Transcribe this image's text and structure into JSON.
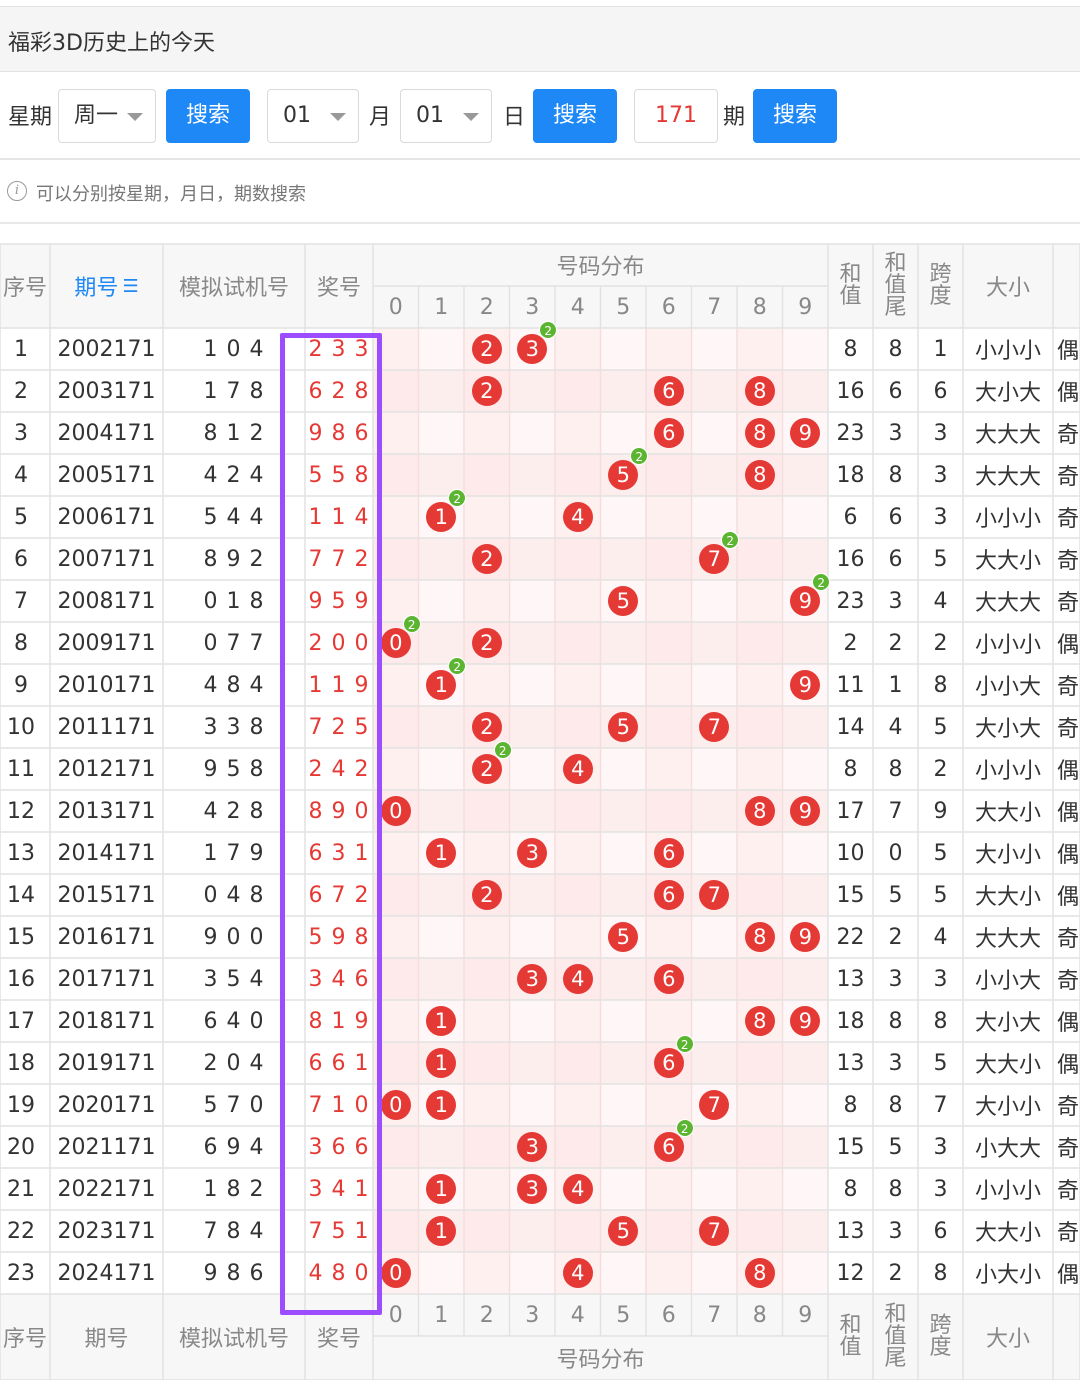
{
  "title": "福彩3D历史上的今天",
  "filters": {
    "weekday_label": "星期",
    "weekday_value": "周一",
    "search_label": "搜索",
    "month_value": "01",
    "month_label": "月",
    "day_value": "01",
    "day_label": "日",
    "issue_value": "171",
    "issue_label": "期"
  },
  "tip": "可以分别按星期，月日，期数搜索",
  "colors": {
    "ball": "#e53935",
    "badge": "#5cb531",
    "button": "#1e88f7",
    "highlight": "#9b4dff"
  },
  "table": {
    "headers": {
      "seq": "序号",
      "issue": "期号",
      "sim": "模拟试机号",
      "prize": "奖号",
      "dist": "号码分布",
      "sum": "和值",
      "tail": "和值尾",
      "span": "跨度",
      "size": "大小"
    },
    "digits": [
      "0",
      "1",
      "2",
      "3",
      "4",
      "5",
      "6",
      "7",
      "8",
      "9"
    ],
    "rows": [
      {
        "seq": "1",
        "issue": "2002171",
        "sim": "1 0 4",
        "prize": "2 3 3",
        "sum": "8",
        "tail": "8",
        "span": "1",
        "size": "小小小",
        "odd": "偶"
      },
      {
        "seq": "2",
        "issue": "2003171",
        "sim": "1 7 8",
        "prize": "6 2 8",
        "sum": "16",
        "tail": "6",
        "span": "6",
        "size": "大小大",
        "odd": "偶"
      },
      {
        "seq": "3",
        "issue": "2004171",
        "sim": "8 1 2",
        "prize": "9 8 6",
        "sum": "23",
        "tail": "3",
        "span": "3",
        "size": "大大大",
        "odd": "奇"
      },
      {
        "seq": "4",
        "issue": "2005171",
        "sim": "4 2 4",
        "prize": "5 5 8",
        "sum": "18",
        "tail": "8",
        "span": "3",
        "size": "大大大",
        "odd": "奇"
      },
      {
        "seq": "5",
        "issue": "2006171",
        "sim": "5 4 4",
        "prize": "1 1 4",
        "sum": "6",
        "tail": "6",
        "span": "3",
        "size": "小小小",
        "odd": "奇"
      },
      {
        "seq": "6",
        "issue": "2007171",
        "sim": "8 9 2",
        "prize": "7 7 2",
        "sum": "16",
        "tail": "6",
        "span": "5",
        "size": "大大小",
        "odd": "奇"
      },
      {
        "seq": "7",
        "issue": "2008171",
        "sim": "0 1 8",
        "prize": "9 5 9",
        "sum": "23",
        "tail": "3",
        "span": "4",
        "size": "大大大",
        "odd": "奇"
      },
      {
        "seq": "8",
        "issue": "2009171",
        "sim": "0 7 7",
        "prize": "2 0 0",
        "sum": "2",
        "tail": "2",
        "span": "2",
        "size": "小小小",
        "odd": "偶"
      },
      {
        "seq": "9",
        "issue": "2010171",
        "sim": "4 8 4",
        "prize": "1 1 9",
        "sum": "11",
        "tail": "1",
        "span": "8",
        "size": "小小大",
        "odd": "奇"
      },
      {
        "seq": "10",
        "issue": "2011171",
        "sim": "3 3 8",
        "prize": "7 2 5",
        "sum": "14",
        "tail": "4",
        "span": "5",
        "size": "大小大",
        "odd": "奇"
      },
      {
        "seq": "11",
        "issue": "2012171",
        "sim": "9 5 8",
        "prize": "2 4 2",
        "sum": "8",
        "tail": "8",
        "span": "2",
        "size": "小小小",
        "odd": "偶"
      },
      {
        "seq": "12",
        "issue": "2013171",
        "sim": "4 2 8",
        "prize": "8 9 0",
        "sum": "17",
        "tail": "7",
        "span": "9",
        "size": "大大小",
        "odd": "偶"
      },
      {
        "seq": "13",
        "issue": "2014171",
        "sim": "1 7 9",
        "prize": "6 3 1",
        "sum": "10",
        "tail": "0",
        "span": "5",
        "size": "大小小",
        "odd": "偶"
      },
      {
        "seq": "14",
        "issue": "2015171",
        "sim": "0 4 8",
        "prize": "6 7 2",
        "sum": "15",
        "tail": "5",
        "span": "5",
        "size": "大大小",
        "odd": "偶"
      },
      {
        "seq": "15",
        "issue": "2016171",
        "sim": "9 0 0",
        "prize": "5 9 8",
        "sum": "22",
        "tail": "2",
        "span": "4",
        "size": "大大大",
        "odd": "奇"
      },
      {
        "seq": "16",
        "issue": "2017171",
        "sim": "3 5 4",
        "prize": "3 4 6",
        "sum": "13",
        "tail": "3",
        "span": "3",
        "size": "小小大",
        "odd": "奇"
      },
      {
        "seq": "17",
        "issue": "2018171",
        "sim": "6 4 0",
        "prize": "8 1 9",
        "sum": "18",
        "tail": "8",
        "span": "8",
        "size": "大小大",
        "odd": "偶"
      },
      {
        "seq": "18",
        "issue": "2019171",
        "sim": "2 0 4",
        "prize": "6 6 1",
        "sum": "13",
        "tail": "3",
        "span": "5",
        "size": "大大小",
        "odd": "偶"
      },
      {
        "seq": "19",
        "issue": "2020171",
        "sim": "5 7 0",
        "prize": "7 1 0",
        "sum": "8",
        "tail": "8",
        "span": "7",
        "size": "大小小",
        "odd": "奇"
      },
      {
        "seq": "20",
        "issue": "2021171",
        "sim": "6 9 4",
        "prize": "3 6 6",
        "sum": "15",
        "tail": "5",
        "span": "3",
        "size": "小大大",
        "odd": "奇"
      },
      {
        "seq": "21",
        "issue": "2022171",
        "sim": "1 8 2",
        "prize": "3 4 1",
        "sum": "8",
        "tail": "8",
        "span": "3",
        "size": "小小小",
        "odd": "奇"
      },
      {
        "seq": "22",
        "issue": "2023171",
        "sim": "7 8 4",
        "prize": "7 5 1",
        "sum": "13",
        "tail": "3",
        "span": "6",
        "size": "大大小",
        "odd": "奇"
      },
      {
        "seq": "23",
        "issue": "2024171",
        "sim": "9 8 6",
        "prize": "4 8 0",
        "sum": "12",
        "tail": "2",
        "span": "8",
        "size": "小大小",
        "odd": "偶"
      }
    ]
  }
}
